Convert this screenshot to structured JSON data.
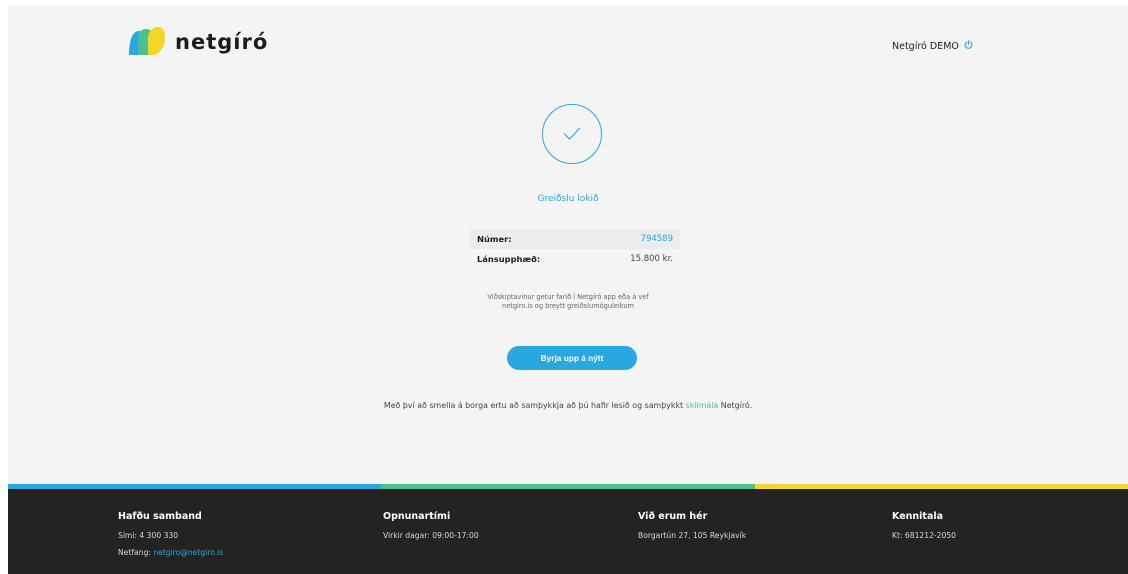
{
  "header": {
    "brand": "netgíró",
    "user": "Netgíró DEMO",
    "logout_icon": "power-icon"
  },
  "status": {
    "icon": "checkmark-icon",
    "text": "Greiðslu lokið"
  },
  "details": {
    "number_label": "Númer:",
    "number_value": "794589",
    "amount_label": "Lánsupphæð:",
    "amount_value": "15.800 kr."
  },
  "note": {
    "line1": "Viðskiptavinur getur farið í Netgíró app eða á vef",
    "line2": "netgiro.is og breytt greiðslumöguleikum"
  },
  "restart_button": "Byrja upp á nýtt",
  "terms": {
    "before": "Með því að smella á borga ertu að samþykkja að þú hafir lesið og samþykkt ",
    "link": "skilmála",
    "after": " Netgíró."
  },
  "footer": {
    "contact": {
      "title": "Hafðu samband",
      "phone": "Sími: 4 300 330",
      "email_label": "Netfang: ",
      "email": "netgiro@netgiro.is"
    },
    "hours": {
      "title": "Opnunartími",
      "text": "Virkir dagar: 09:00-17:00"
    },
    "location": {
      "title": "Við erum hér",
      "text": "Borgartún 27, 105 Reykjavík"
    },
    "id": {
      "title": "Kennitala",
      "text": "Kt: 681212-2050"
    }
  },
  "colors": {
    "accent_blue": "#29a7e1",
    "accent_green": "#50bf8f",
    "accent_yellow": "#f5d626",
    "footer_bg": "#252322"
  }
}
